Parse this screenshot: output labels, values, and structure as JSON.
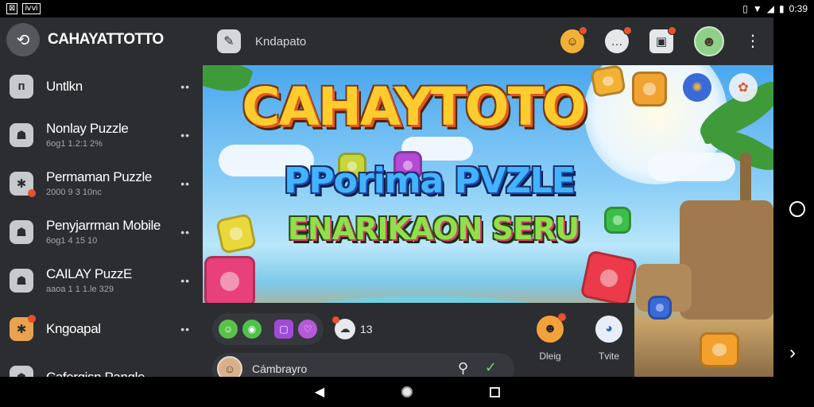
{
  "status_bar": {
    "left_badges": [
      "⊠",
      "ⅳⅵ"
    ],
    "time": "0:39"
  },
  "sidebar": {
    "brand": "CAHAYATTOTTO",
    "items": [
      {
        "title": "Untlkn",
        "subtitle": "",
        "icon": "puzzle-p-icon",
        "glyph": "ᴨ"
      },
      {
        "title": "Nonlay Puzzle",
        "subtitle": "6og1 1.2:1 2%",
        "icon": "robot-icon",
        "glyph": "☗"
      },
      {
        "title": "Permaman Puzzle",
        "subtitle": "2000 9 3 10nc",
        "icon": "puzzle-piece-icon",
        "glyph": "✱"
      },
      {
        "title": "Penyjarrman Mobile",
        "subtitle": "6og1 4 15 10",
        "icon": "robot-icon",
        "glyph": "☗"
      },
      {
        "title": "CAILAY PuzzE",
        "subtitle": "aaoa 1 1 1.le 329",
        "icon": "robot-icon",
        "glyph": "☗"
      },
      {
        "title": "Kngoapal",
        "subtitle": "",
        "icon": "puzzle-orange-icon",
        "glyph": "✱"
      },
      {
        "title": "Cafergisn Pangle",
        "subtitle": "",
        "icon": "robot-icon",
        "glyph": "☗"
      }
    ]
  },
  "header": {
    "title": "Kndapato"
  },
  "banner": {
    "title_line1": "CAHAYTOTO",
    "title_line2": "PPorima PVZLE",
    "title_line3": "ENARIKAON SERU"
  },
  "panel": {
    "reaction_count": "13",
    "actions": [
      {
        "label": "Dleig",
        "icon": "monster-icon"
      },
      {
        "label": "Tvite",
        "icon": "chat-bubble-icon"
      }
    ],
    "user_name": "Cámbrayro"
  },
  "colors": {
    "panel": "#2b2d31",
    "accent_badge": "#e8522a",
    "green": "#5ac24a",
    "purple": "#a04bd6"
  }
}
